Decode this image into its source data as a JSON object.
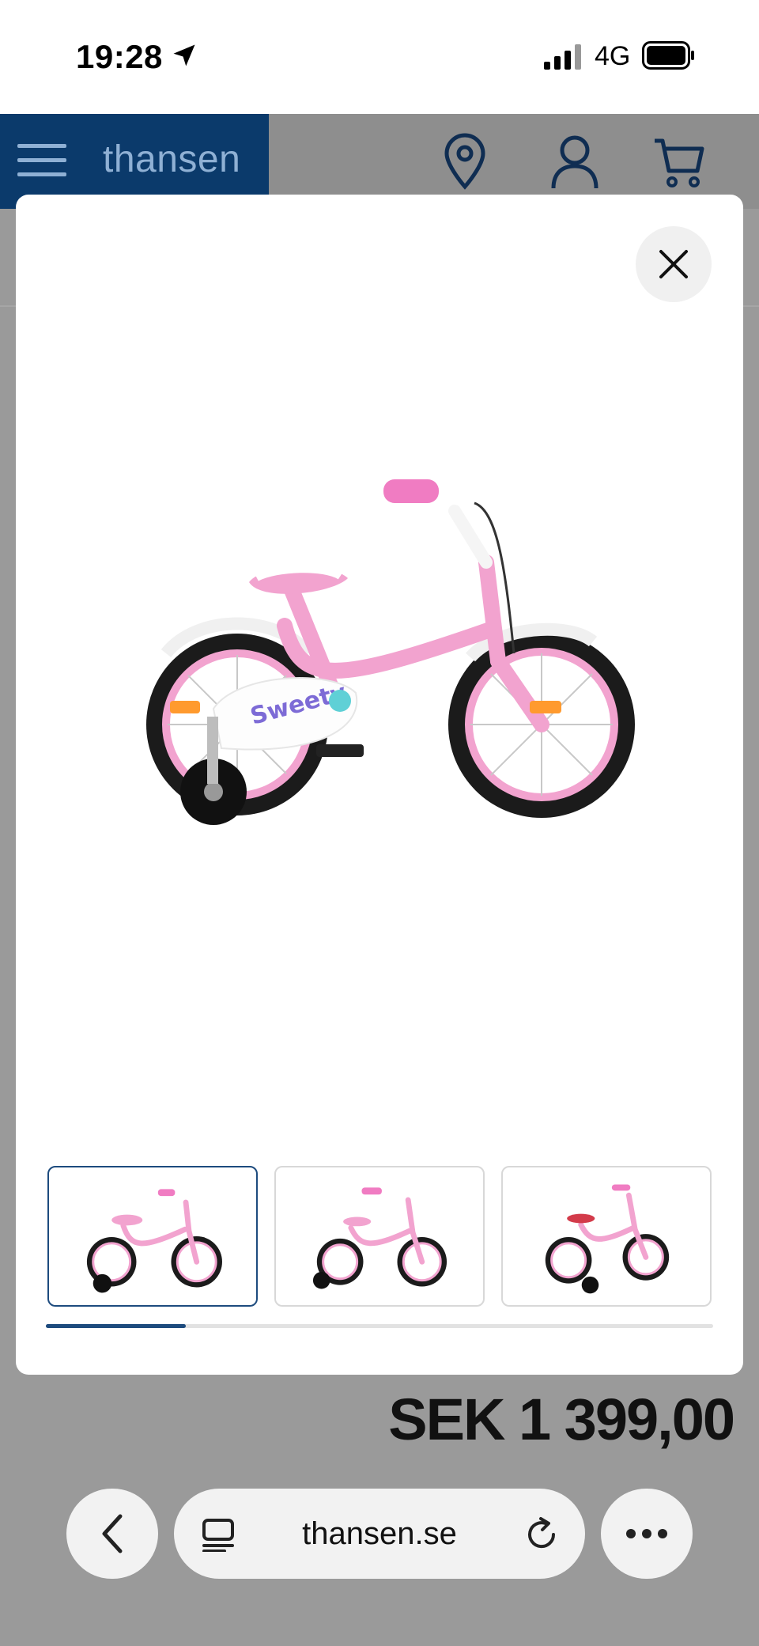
{
  "status_bar": {
    "time": "19:28",
    "network": "4G",
    "icons": [
      "location-arrow-icon",
      "signal-icon",
      "battery-icon"
    ]
  },
  "header": {
    "brand": "thansen",
    "icons": [
      "menu-icon",
      "store-location-icon",
      "account-icon",
      "cart-icon"
    ],
    "brand_color": "#0b3a6b"
  },
  "modal": {
    "close_icon": "close-icon",
    "main_image": "pink-kids-bike-with-training-wheels",
    "frame_decal_text": "Sweety",
    "thumbnails": [
      {
        "image": "pink-bike-view-1",
        "active": true
      },
      {
        "image": "pink-bike-view-2",
        "active": false
      },
      {
        "image": "pink-bike-view-3",
        "active": false
      }
    ],
    "gallery_progress": 0.21
  },
  "price": {
    "text": "SEK 1 399,00"
  },
  "browser": {
    "url": "thansen.se",
    "icons": [
      "back-icon",
      "tabs-icon",
      "reload-icon",
      "more-icon"
    ]
  },
  "colors": {
    "accent": "#1d4b7e",
    "bike_pink": "#f2a3cf",
    "overlay": "#9a9a9a"
  }
}
